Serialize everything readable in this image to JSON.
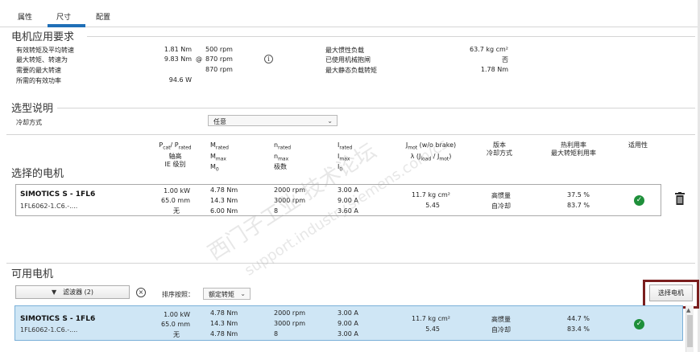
{
  "tabs": [
    {
      "label": "属性"
    },
    {
      "label": "尺寸"
    },
    {
      "label": "配置"
    }
  ],
  "requirements": {
    "title": "电机应用要求",
    "rows": [
      {
        "label": "有效转矩及平均转速",
        "torque": "1.81 Nm",
        "speed": "500 rpm"
      },
      {
        "label": "最大转矩、转速为",
        "torque": "9.83 Nm",
        "at": "@",
        "speed": "870 rpm"
      },
      {
        "label": "需要的最大转速",
        "speed": "870 rpm"
      },
      {
        "label": "所需的有效功率",
        "torque": "94.6 W"
      }
    ],
    "right_rows": [
      {
        "label": "最大惯性负载",
        "value": "63.7 kg cm²"
      },
      {
        "label": "已使用机械抱闸",
        "value": "否"
      },
      {
        "label": "最大静态负载转矩",
        "value": "1.78 Nm"
      }
    ]
  },
  "selection_notes": {
    "title": "选型说明",
    "cooling_label": "冷却方式",
    "cooling_value": "任意"
  },
  "table_headers": {
    "power": [
      "P",
      "/ P",
      "轴高",
      "IE 级别"
    ],
    "torque": [
      "M",
      "M",
      "M"
    ],
    "speed": [
      "n",
      "n",
      "极数"
    ],
    "current": [
      "I",
      "I",
      "I"
    ],
    "inertia": [
      "J",
      " (w/o brake)",
      "λ (J",
      " / J",
      ")"
    ],
    "version": [
      "版本",
      "冷却方式"
    ],
    "util": [
      "热利用率",
      "最大转矩利用率"
    ],
    "suitability": "适用性"
  },
  "subscripts": {
    "cat": "cat",
    "rated": "rated",
    "max": "max",
    "zero": "0",
    "mot": "mot",
    "load": "load"
  },
  "selected_motor": {
    "title": "选择的电机",
    "name": "SIMOTICS S - 1FL6",
    "code": "1FL6062-1.C6.-....",
    "power": "1.00 kW",
    "shaft": "65.0 mm",
    "ie": "无",
    "m_rated": "4.78 Nm",
    "m_max": "14.3 Nm",
    "m0": "6.00 Nm",
    "n_rated": "2000 rpm",
    "n_max": "3000 rpm",
    "poles": "8",
    "i_rated": "3.00 A",
    "i_max": "9.00 A",
    "i0": "3.60 A",
    "j_mot": "11.7 kg cm²",
    "lambda": "5.45",
    "version": "高惯量",
    "cooling": "自冷却",
    "thermal": "37.5 %",
    "torque_util": "83.7 %"
  },
  "available": {
    "title": "可用电机",
    "filter_label": "滤波器 (2)",
    "sort_label": "排序按照：",
    "sort_value": "额定转矩",
    "select_button": "选择电机",
    "motor": {
      "name": "SIMOTICS S - 1FL6",
      "code": "1FL6062-1.C6.-....",
      "power": "1.00 kW",
      "shaft": "65.0 mm",
      "ie": "无",
      "m_rated": "4.78 Nm",
      "m_max": "14.3 Nm",
      "m0": "4.78 Nm",
      "n_rated": "2000 rpm",
      "n_max": "3000 rpm",
      "poles": "8",
      "i_rated": "3.00 A",
      "i_max": "9.00 A",
      "i0": "3.00 A",
      "j_mot": "11.7 kg cm²",
      "lambda": "5.45",
      "version": "高惯量",
      "cooling": "自冷却",
      "thermal": "44.7 %",
      "torque_util": "83.4 %"
    }
  },
  "watermark": {
    "line1": "西门子工业  技术论坛",
    "line2": "support.industry.siemens.com/cs"
  },
  "colors": {
    "accent": "#1f6fb7",
    "check": "#1e8f3a",
    "selected_row": "#cfe6f5",
    "highlight_frame": "#7a1e1e"
  }
}
